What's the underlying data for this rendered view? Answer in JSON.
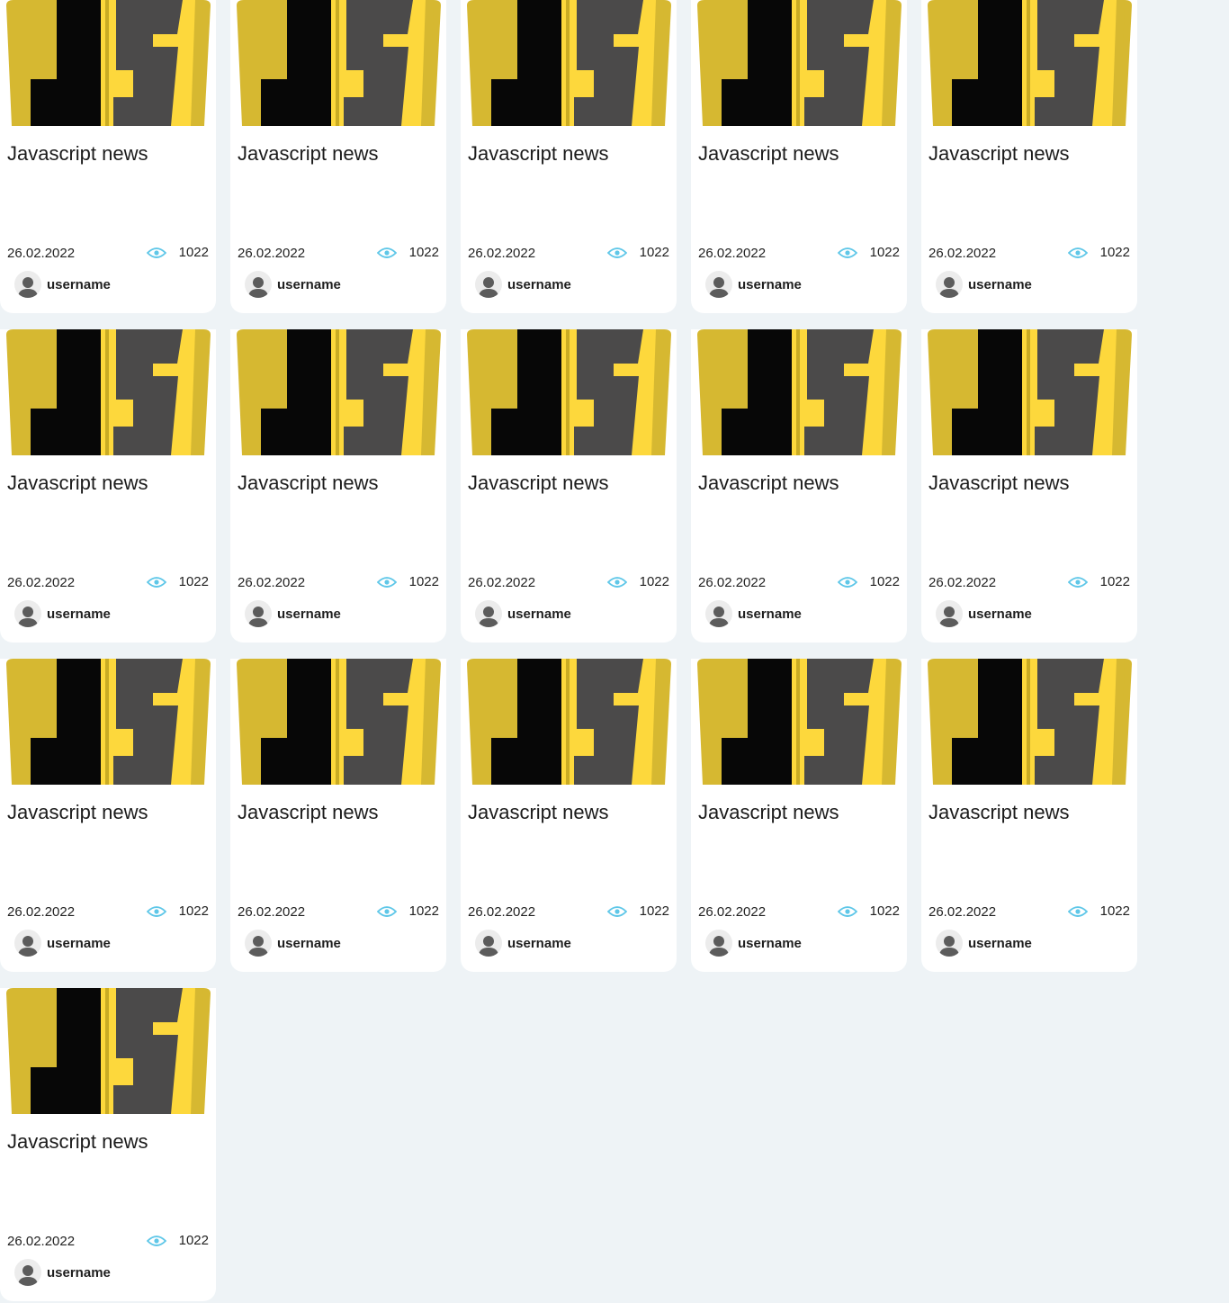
{
  "colors": {
    "page_bg": "#eef3f6",
    "card_bg": "#ffffff",
    "js_yellow": "#d6b831",
    "js_yellow_light": "#fdd83c",
    "js_dark": "#4b4a4a",
    "eye_icon": "#5fc7e8"
  },
  "cards": [
    {
      "title": "Javascript news",
      "date": "26.02.2022",
      "views": "1022",
      "author": "username",
      "thumbnail_icon": "js-logo-icon"
    },
    {
      "title": "Javascript news",
      "date": "26.02.2022",
      "views": "1022",
      "author": "username",
      "thumbnail_icon": "js-logo-icon"
    },
    {
      "title": "Javascript news",
      "date": "26.02.2022",
      "views": "1022",
      "author": "username",
      "thumbnail_icon": "js-logo-icon"
    },
    {
      "title": "Javascript news",
      "date": "26.02.2022",
      "views": "1022",
      "author": "username",
      "thumbnail_icon": "js-logo-icon"
    },
    {
      "title": "Javascript news",
      "date": "26.02.2022",
      "views": "1022",
      "author": "username",
      "thumbnail_icon": "js-logo-icon"
    },
    {
      "title": "Javascript news",
      "date": "26.02.2022",
      "views": "1022",
      "author": "username",
      "thumbnail_icon": "js-logo-icon"
    },
    {
      "title": "Javascript news",
      "date": "26.02.2022",
      "views": "1022",
      "author": "username",
      "thumbnail_icon": "js-logo-icon"
    },
    {
      "title": "Javascript news",
      "date": "26.02.2022",
      "views": "1022",
      "author": "username",
      "thumbnail_icon": "js-logo-icon"
    },
    {
      "title": "Javascript news",
      "date": "26.02.2022",
      "views": "1022",
      "author": "username",
      "thumbnail_icon": "js-logo-icon"
    },
    {
      "title": "Javascript news",
      "date": "26.02.2022",
      "views": "1022",
      "author": "username",
      "thumbnail_icon": "js-logo-icon"
    },
    {
      "title": "Javascript news",
      "date": "26.02.2022",
      "views": "1022",
      "author": "username",
      "thumbnail_icon": "js-logo-icon"
    },
    {
      "title": "Javascript news",
      "date": "26.02.2022",
      "views": "1022",
      "author": "username",
      "thumbnail_icon": "js-logo-icon"
    },
    {
      "title": "Javascript news",
      "date": "26.02.2022",
      "views": "1022",
      "author": "username",
      "thumbnail_icon": "js-logo-icon"
    },
    {
      "title": "Javascript news",
      "date": "26.02.2022",
      "views": "1022",
      "author": "username",
      "thumbnail_icon": "js-logo-icon"
    },
    {
      "title": "Javascript news",
      "date": "26.02.2022",
      "views": "1022",
      "author": "username",
      "thumbnail_icon": "js-logo-icon"
    },
    {
      "title": "Javascript news",
      "date": "26.02.2022",
      "views": "1022",
      "author": "username",
      "thumbnail_icon": "js-logo-icon"
    }
  ]
}
